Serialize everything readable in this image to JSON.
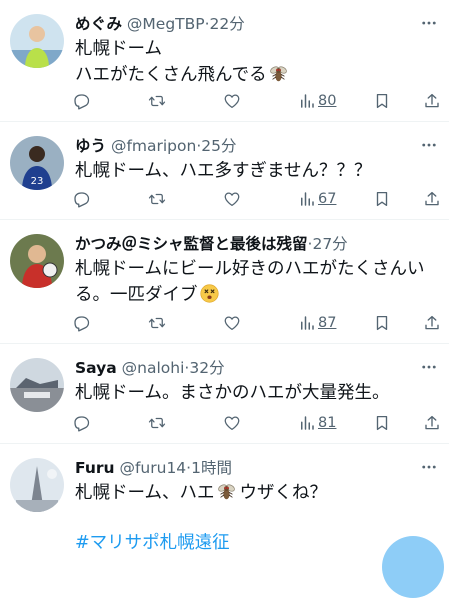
{
  "tweets": [
    {
      "name": "めぐみ",
      "handle": "@MegTBP",
      "dot": "·",
      "time": "22分",
      "lines": [
        "札幌ドーム",
        "ハエがたくさん飛んでる"
      ],
      "views": "80"
    },
    {
      "name": "ゆう",
      "handle": "@fmaripon",
      "dot": "·",
      "time": "25分",
      "lines": [
        "札幌ドーム、ハエ多すぎません？？？"
      ],
      "views": "67"
    },
    {
      "name": "かつみ＠ミシャ監督と最後は残留",
      "handle": "",
      "dot": "·",
      "time": "27分",
      "lines": [
        "札幌ドームにビール好きのハエがたくさんい",
        "る。一匹ダイブ"
      ],
      "views": "87"
    },
    {
      "name": "Saya",
      "handle": "@nalohi",
      "dot": "·",
      "time": "32分",
      "lines": [
        "札幌ドーム。まさかのハエが大量発生。"
      ],
      "views": "81"
    },
    {
      "name": "Furu",
      "handle": "@furu14",
      "dot": "·",
      "time": "1時間",
      "lines": [
        "札幌ドーム、ハエ",
        "ウザくね？"
      ],
      "hashtag": "#マリサポ札幌遠征"
    }
  ],
  "icons": {
    "more": "more-horizontal-icon",
    "reply": "reply-icon",
    "retweet": "retweet-icon",
    "like": "heart-icon",
    "views": "views-chart-icon",
    "bookmark": "bookmark-icon",
    "share": "share-icon",
    "fly": "fly-emoji",
    "dizzy": "dizzy-face-emoji"
  },
  "colors": {
    "text": "#0f1419",
    "secondary": "#536471",
    "link": "#1d9bf0",
    "divider": "#eff3f4"
  }
}
